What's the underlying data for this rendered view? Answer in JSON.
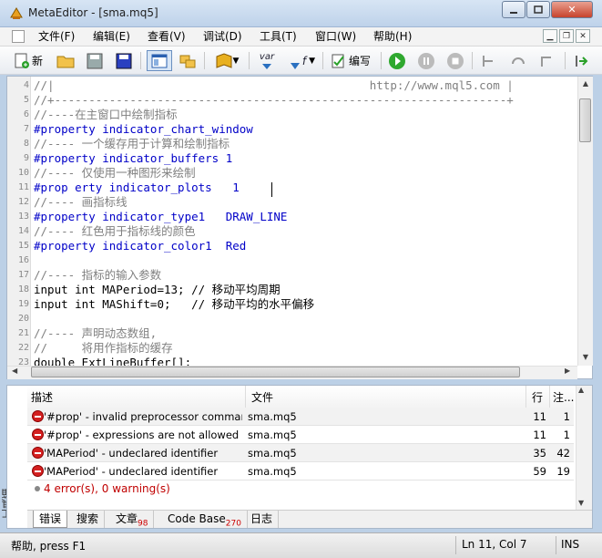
{
  "window": {
    "title": "MetaEditor - [sma.mq5]",
    "min": "0",
    "max": "□",
    "close": "✕"
  },
  "menu": [
    "文件(F)",
    "编辑(E)",
    "查看(V)",
    "调试(D)",
    "工具(T)",
    "窗口(W)",
    "帮助(H)"
  ],
  "toolbar": {
    "new_label": "新",
    "compile_label": "编写",
    "var_label": "var",
    "func_label": "f"
  },
  "editor": {
    "lines": [
      {
        "n": "4",
        "t": "//|                                              http://www.mql5.com |",
        "c": "cm"
      },
      {
        "n": "5",
        "t": "//+------------------------------------------------------------------+",
        "c": "cm"
      },
      {
        "n": "6",
        "t": "//----在主窗口中绘制指标",
        "c": "cm"
      },
      {
        "n": "7",
        "t": "#property indicator_chart_window",
        "c": "pp"
      },
      {
        "n": "8",
        "t": "//---- 一个缓存用于计算和绘制指标",
        "c": "cm"
      },
      {
        "n": "9",
        "t": "#property indicator_buffers 1",
        "c": "pp"
      },
      {
        "n": "10",
        "t": "//---- 仅使用一种图形来绘制",
        "c": "cm"
      },
      {
        "n": "11",
        "t": "#prop erty indicator_plots   1",
        "c": "pp"
      },
      {
        "n": "12",
        "t": "//---- 画指标线",
        "c": "cm"
      },
      {
        "n": "13",
        "t": "#property indicator_type1   DRAW_LINE",
        "c": "pp"
      },
      {
        "n": "14",
        "t": "//---- 红色用于指标线的颜色",
        "c": "cm"
      },
      {
        "n": "15",
        "t": "#property indicator_color1  Red",
        "c": "pp"
      },
      {
        "n": "16",
        "t": "",
        "c": "tx"
      },
      {
        "n": "17",
        "t": "//---- 指标的输入参数",
        "c": "cm"
      },
      {
        "n": "18",
        "t": "input int MAPeriod=13; // 移动平均周期",
        "c": "tx"
      },
      {
        "n": "19",
        "t": "input int MAShift=0;   // 移动平均的水平偏移",
        "c": "tx"
      },
      {
        "n": "20",
        "t": "",
        "c": "tx"
      },
      {
        "n": "21",
        "t": "//---- 声明动态数组,",
        "c": "cm"
      },
      {
        "n": "22",
        "t": "//     将用作指标的缓存",
        "c": "cm"
      },
      {
        "n": "23",
        "t": "double ExtLineBuffer[];",
        "c": "tx"
      }
    ]
  },
  "toolbox": {
    "close": "×",
    "side_label": "工具箱",
    "columns": [
      "描述",
      "文件",
      "行",
      "注..."
    ],
    "rows": [
      {
        "desc": "'#prop' - invalid preprocessor command",
        "file": "sma.mq5",
        "line": "11",
        "col": "1"
      },
      {
        "desc": "'#prop' - expressions are not allowed o...",
        "file": "sma.mq5",
        "line": "11",
        "col": "1"
      },
      {
        "desc": "'MAPeriod' - undeclared identifier",
        "file": "sma.mq5",
        "line": "35",
        "col": "42"
      },
      {
        "desc": "'MAPeriod' - undeclared identifier",
        "file": "sma.mq5",
        "line": "59",
        "col": "19"
      }
    ],
    "summary": "4 error(s), 0 warning(s)",
    "tabs": [
      {
        "label": "错误",
        "badge": ""
      },
      {
        "label": "搜索",
        "badge": ""
      },
      {
        "label": "文章",
        "badge": "98"
      },
      {
        "label": "Code Base",
        "badge": "270"
      },
      {
        "label": "日志",
        "badge": ""
      }
    ]
  },
  "status": {
    "help": "帮助, press F1",
    "position": "Ln 11, Col 7",
    "mode": "INS"
  },
  "colors": {
    "error": "#d42020",
    "comment": "#808080",
    "keyword": "#0000c8",
    "number": "#008000"
  }
}
